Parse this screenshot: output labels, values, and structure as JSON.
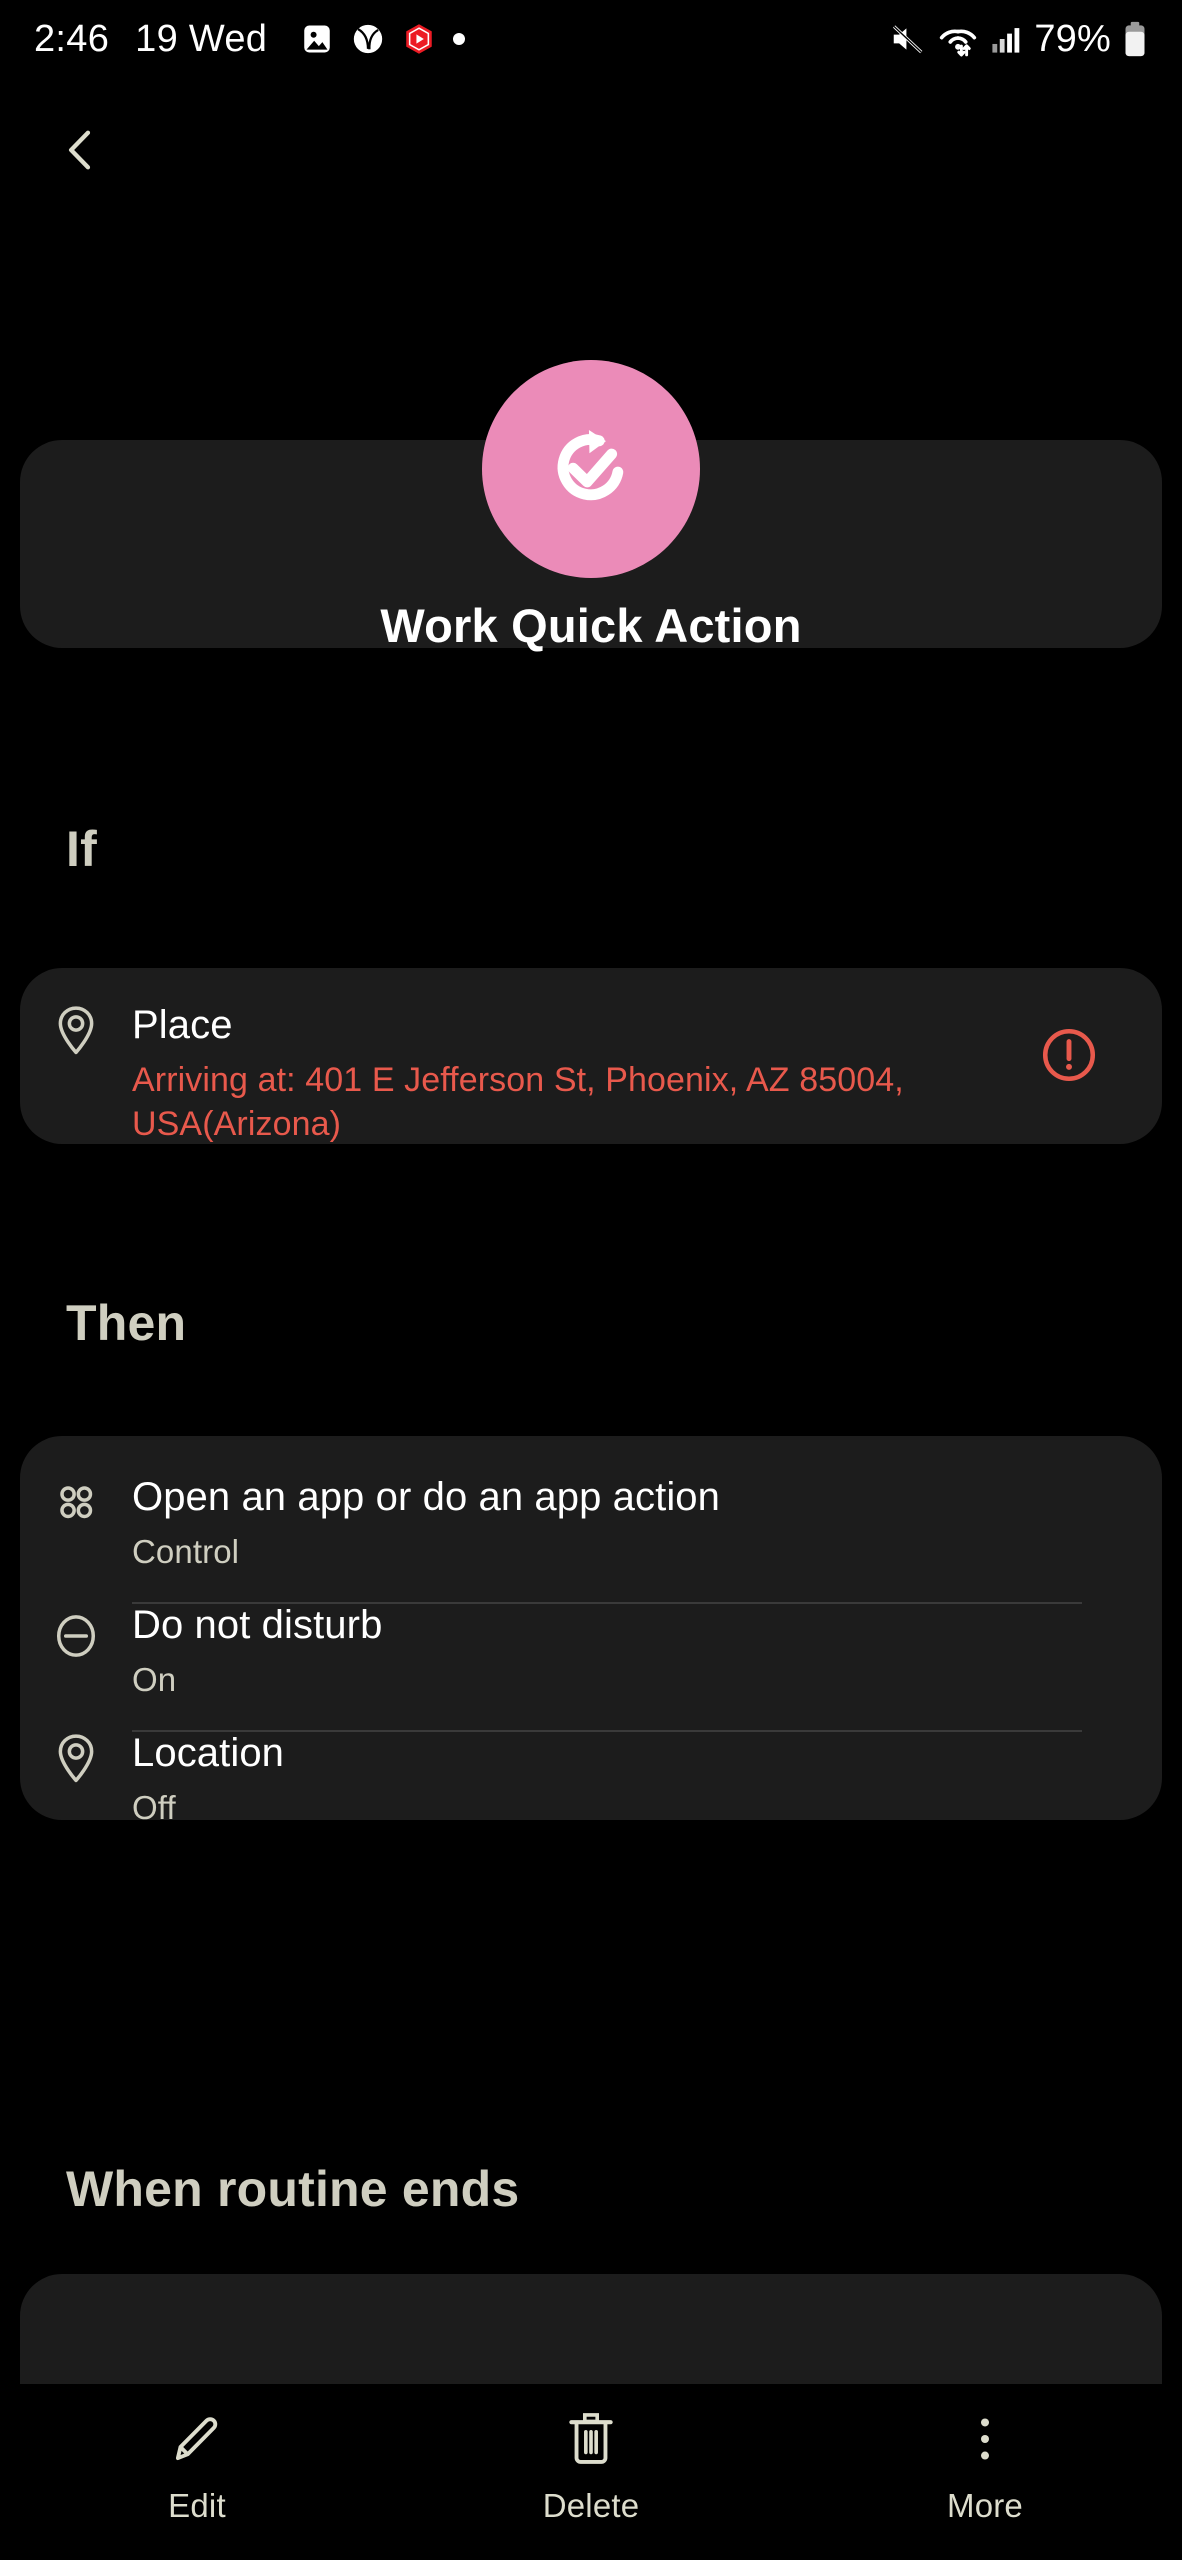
{
  "status_bar": {
    "time": "2:46",
    "date": "19 Wed",
    "battery_percent": "79%",
    "left_icons": [
      "gallery-icon",
      "sports-ball-icon",
      "youtube-icon",
      "dot-icon"
    ],
    "right_icons": [
      "mute-icon",
      "wifi-icon",
      "signal-icon",
      "battery-icon"
    ]
  },
  "nav": {
    "back_label": "Back"
  },
  "header": {
    "icon": "routine-refresh-check-icon",
    "icon_color": "#eb8bb8",
    "title": "Work Quick Action"
  },
  "sections": {
    "if": {
      "heading": "If",
      "items": [
        {
          "icon": "location-pin-icon",
          "title": "Place",
          "subtitle": "Arriving at: 401 E Jefferson St, Phoenix, AZ 85004, USA(Arizona)",
          "subtitle_state": "error",
          "trailing_icon": "error-exclamation-icon"
        }
      ]
    },
    "then": {
      "heading": "Then",
      "items": [
        {
          "icon": "app-grid-icon",
          "title": "Open an app or do an app action",
          "subtitle": "Control"
        },
        {
          "icon": "do-not-disturb-icon",
          "title": "Do not disturb",
          "subtitle": "On"
        },
        {
          "icon": "location-pin-icon",
          "title": "Location",
          "subtitle": "Off"
        }
      ]
    },
    "when_routine_ends": {
      "heading": "When routine ends"
    }
  },
  "bottom_bar": {
    "items": [
      {
        "icon": "pencil-icon",
        "label": "Edit"
      },
      {
        "icon": "trash-icon",
        "label": "Delete"
      },
      {
        "icon": "more-vertical-icon",
        "label": "More"
      }
    ]
  },
  "colors": {
    "background": "#000000",
    "card": "#1c1c1c",
    "accent_pink": "#eb8bb8",
    "error_red": "#e8594c",
    "cream": "#cfcec0"
  }
}
